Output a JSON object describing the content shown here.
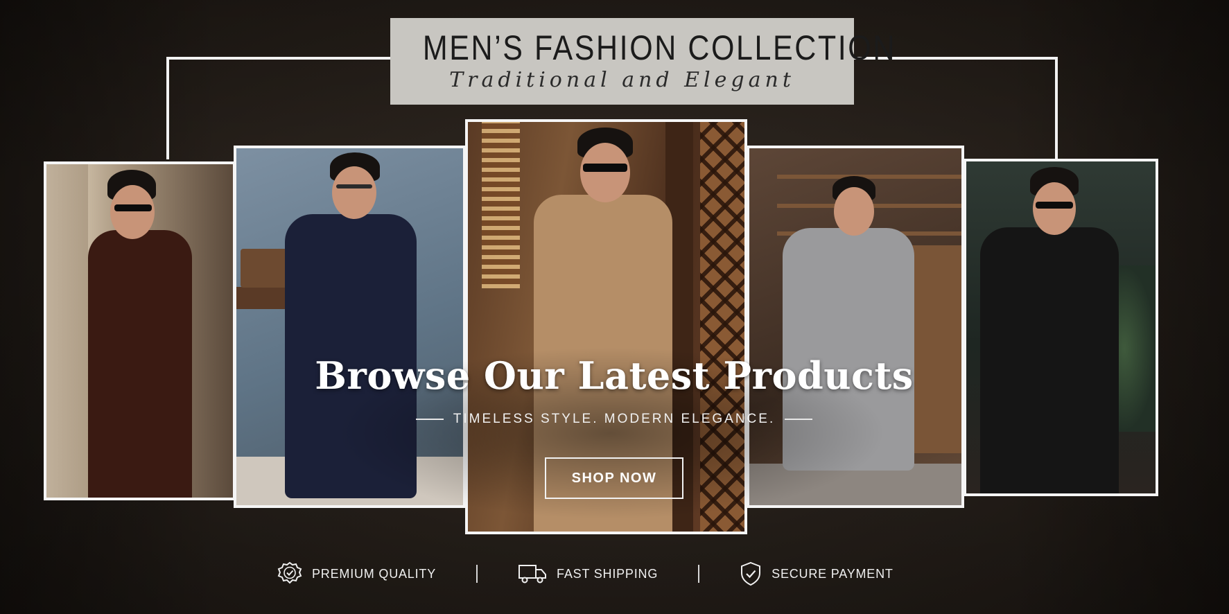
{
  "header": {
    "title": "MEN’S FASHION COLLECTION",
    "subtitle": "Traditional and Elegant"
  },
  "hero": {
    "headline": "Browse Our Latest Products",
    "tagline": "TIMELESS STYLE. MODERN ELEGANCE.",
    "cta_label": "SHOP NOW"
  },
  "gallery": [
    {
      "outfit": "brown kurta",
      "color": "#3a1a12"
    },
    {
      "outfit": "navy kurta",
      "color": "#1b2038"
    },
    {
      "outfit": "beige kurta",
      "color": "#b58e67"
    },
    {
      "outfit": "grey kurta",
      "color": "#9a9a9c"
    },
    {
      "outfit": "black kurta",
      "color": "#151515"
    }
  ],
  "features": [
    {
      "label": "PREMIUM QUALITY",
      "icon": "badge-check-icon"
    },
    {
      "label": "FAST SHIPPING",
      "icon": "truck-icon"
    },
    {
      "label": "SECURE PAYMENT",
      "icon": "shield-check-icon"
    }
  ],
  "colors": {
    "background": "#2a231d",
    "title_box": "#c8c6c1",
    "frame": "#f5f5f5",
    "text": "#ffffff"
  }
}
